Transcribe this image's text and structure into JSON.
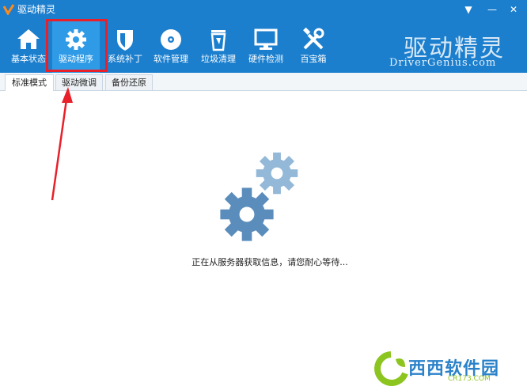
{
  "window": {
    "title": "驱动精灵",
    "controls": {
      "menu": "▼",
      "minimize": "—",
      "close": "✕"
    }
  },
  "toolbar": {
    "items": [
      {
        "label": "基本状态",
        "icon": "home-icon"
      },
      {
        "label": "驱动程序",
        "icon": "gear-icon",
        "active": true
      },
      {
        "label": "系统补丁",
        "icon": "shield-icon"
      },
      {
        "label": "软件管理",
        "icon": "disc-icon"
      },
      {
        "label": "垃圾清理",
        "icon": "recycle-bin-icon"
      },
      {
        "label": "硬件检测",
        "icon": "monitor-icon"
      },
      {
        "label": "百宝箱",
        "icon": "tools-icon"
      }
    ]
  },
  "brand": {
    "title": "驱动精灵",
    "subtitle": "DriverGenius.com"
  },
  "tabs": [
    {
      "label": "标准模式",
      "active": true
    },
    {
      "label": "驱动微调"
    },
    {
      "label": "备份还原"
    }
  ],
  "main": {
    "status_text": "正在从服务器获取信息，请您耐心等待..."
  },
  "watermark": {
    "text": "西西软件园",
    "sub": "CR173.COM"
  },
  "colors": {
    "titlebar": "#1c7fce",
    "toolbar_active": "#2f9be6",
    "highlight": "#e8202a",
    "gear_dark": "#5b8dbc",
    "gear_light": "#93b8d8"
  }
}
